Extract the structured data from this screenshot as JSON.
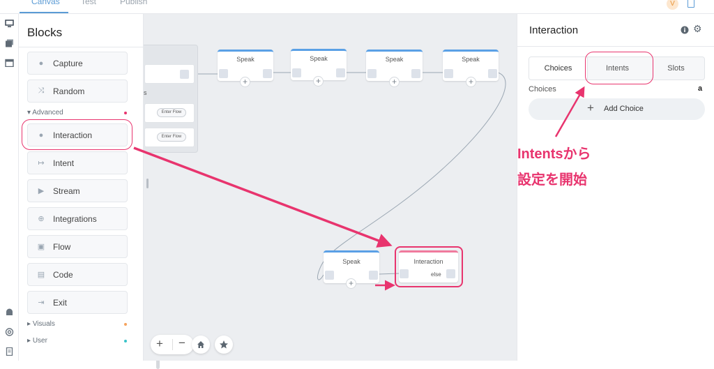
{
  "topbar": {
    "tabs": [
      {
        "label": "Canvas",
        "active": true
      },
      {
        "label": "Test",
        "active": false
      },
      {
        "label": "Publish",
        "active": false
      }
    ],
    "avatar_initial": "V"
  },
  "blocks_panel": {
    "title": "Blocks",
    "items_top": [
      {
        "label": "Capture",
        "icon": "mic-icon"
      },
      {
        "label": "Random",
        "icon": "shuffle-icon"
      }
    ],
    "advanced_label": "Advanced",
    "items_advanced": [
      {
        "label": "Interaction",
        "icon": "person-icon"
      },
      {
        "label": "Intent",
        "icon": "arrow-in-icon"
      },
      {
        "label": "Stream",
        "icon": "play-icon"
      },
      {
        "label": "Integrations",
        "icon": "globe-icon"
      },
      {
        "label": "Flow",
        "icon": "layers-icon"
      },
      {
        "label": "Code",
        "icon": "code-icon"
      },
      {
        "label": "Exit",
        "icon": "exit-icon"
      }
    ],
    "sections_bottom": [
      {
        "label": "Visuals",
        "color": "#f5a25d"
      },
      {
        "label": "User",
        "color": "#39c3c9"
      }
    ],
    "advanced_color": "#e8346e"
  },
  "canvas": {
    "group_partial_label": "ds",
    "enter_flow_label": "Enter Flow",
    "speak_label": "Speak",
    "interaction_node_title": "Interaction",
    "interaction_else_label": "else",
    "plus_glyph": "+"
  },
  "right_panel": {
    "title": "Interaction",
    "tabs": [
      "Choices",
      "Intents",
      "Slots"
    ],
    "choices_label": "Choices",
    "amazon_glyph": "a",
    "add_choice_label": "Add Choice"
  },
  "annotation": {
    "line1": "Intentsから",
    "line2": "設定を開始",
    "color": "#e8346e"
  }
}
